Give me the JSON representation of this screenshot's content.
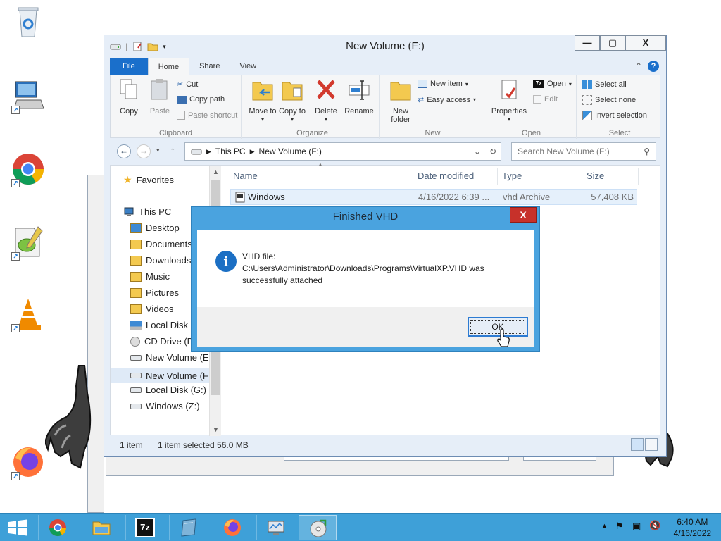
{
  "explorer": {
    "title": "New Volume (F:)",
    "window_controls": {
      "minimize": "—",
      "maximize": "▢",
      "close": "X"
    },
    "tabs": {
      "file": "File",
      "home": "Home",
      "share": "Share",
      "view": "View"
    },
    "ribbon": {
      "clipboard": {
        "label": "Clipboard",
        "copy": "Copy",
        "paste": "Paste",
        "cut": "Cut",
        "copy_path": "Copy path",
        "paste_shortcut": "Paste shortcut"
      },
      "organize": {
        "label": "Organize",
        "move_to": "Move to",
        "copy_to": "Copy to",
        "delete": "Delete",
        "rename": "Rename"
      },
      "new": {
        "label": "New",
        "new_folder": "New folder",
        "new_item": "New item",
        "easy_access": "Easy access"
      },
      "open": {
        "label": "Open",
        "properties": "Properties",
        "open": "Open",
        "edit": "Edit"
      },
      "select": {
        "label": "Select",
        "select_all": "Select all",
        "select_none": "Select none",
        "invert_selection": "Invert selection"
      }
    },
    "address": {
      "crumbs": [
        "This PC",
        "New Volume (F:)"
      ],
      "search_placeholder": "Search New Volume (F:)"
    },
    "nav": {
      "favorites": "Favorites",
      "this_pc": "This PC",
      "items": [
        "Desktop",
        "Documents",
        "Downloads",
        "Music",
        "Pictures",
        "Videos",
        "Local Disk (",
        "CD Drive (D",
        "New Volume (E",
        "New Volume (F",
        "Local Disk (G:)",
        "Windows (Z:)"
      ]
    },
    "columns": {
      "name": "Name",
      "date": "Date modified",
      "type": "Type",
      "size": "Size"
    },
    "files": [
      {
        "name": "Windows",
        "date": "4/16/2022 6:39 ...",
        "type": "vhd Archive",
        "size": "57,408 KB"
      }
    ],
    "status": {
      "count": "1 item",
      "selected": "1 item selected  56.0 MB"
    }
  },
  "dialog": {
    "title": "Finished VHD",
    "close": "X",
    "message_line1": "VHD file:",
    "message_line2": "C:\\Users\\Administrator\\Downloads\\Programs\\VirtualXP.VHD was",
    "message_line3": "successfully attached",
    "ok": "OK"
  },
  "taskbar": {
    "time": "6:40 AM",
    "date": "4/16/2022",
    "apps": [
      "chrome-icon",
      "file-explorer-icon",
      "7zip-icon",
      "notepad-icon",
      "firefox-icon",
      "system-monitor-icon",
      "disc-tool-icon"
    ],
    "sevenzip_label": "7z"
  },
  "colors": {
    "taskbar": "#3ea0d8",
    "file_tab": "#1a6fcb",
    "dialog_frame": "#4aa3df",
    "dialog_close": "#c7312a"
  }
}
